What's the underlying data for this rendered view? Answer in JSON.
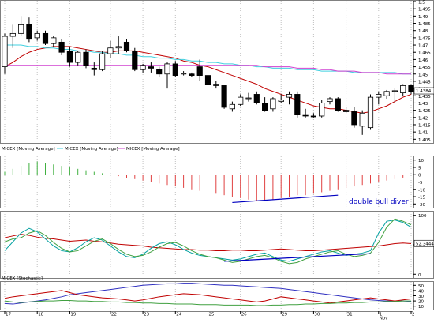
{
  "chart_data": [
    {
      "type": "candlestick",
      "title": "",
      "y_ticks": [
        "1.405",
        "1.41",
        "1.415",
        "1.42",
        "1.425",
        "1.43",
        "1.435",
        "1.44",
        "1.445",
        "1.45",
        "1.455",
        "1.46",
        "1.465",
        "1.47",
        "1.475",
        "1.48",
        "1.485",
        "1.49",
        "1.495",
        "1.5"
      ],
      "ylim": [
        1.403,
        1.5
      ],
      "last_value_label": "1.4384",
      "last_value": 1.4384,
      "legend": [
        {
          "label": "MICEX [Moving Average]",
          "color": "#a00000"
        },
        {
          "label": "MICEX [Moving Average]",
          "color": "#40d0e0"
        },
        {
          "label": "MICEX [Moving Average]",
          "color": "#d040d0"
        }
      ],
      "candles": [
        {
          "o": 1.455,
          "h": 1.478,
          "l": 1.45,
          "c": 1.476
        },
        {
          "o": 1.476,
          "h": 1.484,
          "l": 1.468,
          "c": 1.478
        },
        {
          "o": 1.478,
          "h": 1.49,
          "l": 1.476,
          "c": 1.484
        },
        {
          "o": 1.484,
          "h": 1.489,
          "l": 1.472,
          "c": 1.474
        },
        {
          "o": 1.475,
          "h": 1.48,
          "l": 1.473,
          "c": 1.478
        },
        {
          "o": 1.478,
          "h": 1.48,
          "l": 1.47,
          "c": 1.471
        },
        {
          "o": 1.471,
          "h": 1.476,
          "l": 1.469,
          "c": 1.475
        },
        {
          "o": 1.472,
          "h": 1.474,
          "l": 1.463,
          "c": 1.465
        },
        {
          "o": 1.466,
          "h": 1.469,
          "l": 1.455,
          "c": 1.458
        },
        {
          "o": 1.458,
          "h": 1.466,
          "l": 1.456,
          "c": 1.465
        },
        {
          "o": 1.465,
          "h": 1.467,
          "l": 1.454,
          "c": 1.456
        },
        {
          "o": 1.454,
          "h": 1.458,
          "l": 1.449,
          "c": 1.453
        },
        {
          "o": 1.453,
          "h": 1.466,
          "l": 1.452,
          "c": 1.464
        },
        {
          "o": 1.464,
          "h": 1.473,
          "l": 1.461,
          "c": 1.468
        },
        {
          "o": 1.468,
          "h": 1.476,
          "l": 1.464,
          "c": 1.469
        },
        {
          "o": 1.472,
          "h": 1.474,
          "l": 1.465,
          "c": 1.466
        },
        {
          "o": 1.466,
          "h": 1.468,
          "l": 1.452,
          "c": 1.453
        },
        {
          "o": 1.453,
          "h": 1.457,
          "l": 1.451,
          "c": 1.456
        },
        {
          "o": 1.455,
          "h": 1.458,
          "l": 1.451,
          "c": 1.454
        },
        {
          "o": 1.453,
          "h": 1.455,
          "l": 1.448,
          "c": 1.45
        },
        {
          "o": 1.45,
          "h": 1.458,
          "l": 1.44,
          "c": 1.457
        },
        {
          "o": 1.457,
          "h": 1.459,
          "l": 1.448,
          "c": 1.449
        },
        {
          "o": 1.45,
          "h": 1.452,
          "l": 1.449,
          "c": 1.4505
        },
        {
          "o": 1.45,
          "h": 1.451,
          "l": 1.448,
          "c": 1.449
        },
        {
          "o": 1.455,
          "h": 1.46,
          "l": 1.445,
          "c": 1.449
        },
        {
          "o": 1.449,
          "h": 1.455,
          "l": 1.441,
          "c": 1.443
        },
        {
          "o": 1.443,
          "h": 1.445,
          "l": 1.44,
          "c": 1.442
        },
        {
          "o": 1.442,
          "h": 1.442,
          "l": 1.426,
          "c": 1.427
        },
        {
          "o": 1.426,
          "h": 1.431,
          "l": 1.424,
          "c": 1.429
        },
        {
          "o": 1.429,
          "h": 1.436,
          "l": 1.428,
          "c": 1.434
        },
        {
          "o": 1.433,
          "h": 1.437,
          "l": 1.431,
          "c": 1.4335
        },
        {
          "o": 1.436,
          "h": 1.438,
          "l": 1.429,
          "c": 1.43
        },
        {
          "o": 1.43,
          "h": 1.434,
          "l": 1.424,
          "c": 1.425
        },
        {
          "o": 1.426,
          "h": 1.434,
          "l": 1.424,
          "c": 1.433
        },
        {
          "o": 1.431,
          "h": 1.436,
          "l": 1.43,
          "c": 1.432
        },
        {
          "o": 1.434,
          "h": 1.438,
          "l": 1.429,
          "c": 1.436
        },
        {
          "o": 1.436,
          "h": 1.438,
          "l": 1.42,
          "c": 1.422
        },
        {
          "o": 1.422,
          "h": 1.426,
          "l": 1.42,
          "c": 1.421
        },
        {
          "o": 1.421,
          "h": 1.423,
          "l": 1.42,
          "c": 1.4205
        },
        {
          "o": 1.421,
          "h": 1.432,
          "l": 1.42,
          "c": 1.43
        },
        {
          "o": 1.431,
          "h": 1.434,
          "l": 1.429,
          "c": 1.433
        },
        {
          "o": 1.433,
          "h": 1.434,
          "l": 1.424,
          "c": 1.425
        },
        {
          "o": 1.425,
          "h": 1.427,
          "l": 1.423,
          "c": 1.424
        },
        {
          "o": 1.424,
          "h": 1.427,
          "l": 1.413,
          "c": 1.415
        },
        {
          "o": 1.414,
          "h": 1.425,
          "l": 1.408,
          "c": 1.423
        },
        {
          "o": 1.413,
          "h": 1.436,
          "l": 1.412,
          "c": 1.434
        },
        {
          "o": 1.434,
          "h": 1.438,
          "l": 1.429,
          "c": 1.436
        },
        {
          "o": 1.435,
          "h": 1.439,
          "l": 1.433,
          "c": 1.438
        },
        {
          "o": 1.438,
          "h": 1.44,
          "l": 1.43,
          "c": 1.4385
        },
        {
          "o": 1.437,
          "h": 1.443,
          "l": 1.435,
          "c": 1.442
        },
        {
          "o": 1.442,
          "h": 1.443,
          "l": 1.436,
          "c": 1.438
        }
      ],
      "moving_averages": [
        {
          "color": "#c00000",
          "values": [
            1.455,
            1.458,
            1.462,
            1.465,
            1.467,
            1.468,
            1.469,
            1.469,
            1.469,
            1.468,
            1.467,
            1.466,
            1.465,
            1.465,
            1.466,
            1.466,
            1.466,
            1.465,
            1.464,
            1.463,
            1.462,
            1.461,
            1.459,
            1.458,
            1.456,
            1.455,
            1.453,
            1.451,
            1.449,
            1.447,
            1.445,
            1.443,
            1.44,
            1.438,
            1.436,
            1.434,
            1.432,
            1.43,
            1.428,
            1.427,
            1.426,
            1.426,
            1.425,
            1.424,
            1.423,
            1.424,
            1.426,
            1.428,
            1.431,
            1.434,
            1.436
          ]
        },
        {
          "color": "#40d0e0",
          "values": [
            1.47,
            1.47,
            1.47,
            1.469,
            1.469,
            1.468,
            1.468,
            1.467,
            1.467,
            1.466,
            1.466,
            1.465,
            1.465,
            1.464,
            1.464,
            1.463,
            1.463,
            1.462,
            1.462,
            1.461,
            1.461,
            1.46,
            1.46,
            1.459,
            1.459,
            1.458,
            1.458,
            1.457,
            1.457,
            1.456,
            1.456,
            1.455,
            1.455,
            1.454,
            1.454,
            1.454,
            1.453,
            1.453,
            1.453,
            1.452,
            1.452,
            1.452,
            1.452,
            1.451,
            1.451,
            1.451,
            1.451,
            1.451,
            1.451,
            1.45,
            1.45
          ]
        },
        {
          "color": "#d040d0",
          "values": [
            1.456,
            1.456,
            1.456,
            1.456,
            1.456,
            1.456,
            1.456,
            1.456,
            1.456,
            1.456,
            1.456,
            1.456,
            1.456,
            1.456,
            1.456,
            1.456,
            1.456,
            1.456,
            1.456,
            1.456,
            1.456,
            1.456,
            1.456,
            1.456,
            1.456,
            1.456,
            1.456,
            1.456,
            1.456,
            1.456,
            1.456,
            1.456,
            1.455,
            1.455,
            1.455,
            1.455,
            1.454,
            1.454,
            1.454,
            1.453,
            1.453,
            1.452,
            1.452,
            1.452,
            1.451,
            1.451,
            1.451,
            1.45,
            1.45,
            1.45,
            1.45
          ]
        }
      ]
    },
    {
      "type": "bar",
      "subtype": "histogram",
      "y_ticks": [
        "10",
        "5",
        "0",
        "-5",
        "-10",
        "-15",
        "-20"
      ],
      "ylim": [
        -22,
        12
      ],
      "values": [
        2,
        4,
        6,
        8,
        9,
        8,
        7,
        6,
        5,
        4,
        3,
        2,
        1,
        0,
        -1,
        -2,
        -3,
        -4,
        -5,
        -6,
        -7,
        -8,
        -9,
        -10,
        -11,
        -12,
        -13,
        -14,
        -15,
        -16,
        -17,
        -18,
        -18,
        -17,
        -16,
        -15,
        -14,
        -14,
        -13,
        -12,
        -11,
        -10,
        -9,
        -8,
        -7,
        -6,
        -5,
        -4,
        -3,
        -2
      ],
      "annotation_text": "double bull diver",
      "trendline": {
        "from_index": 28,
        "from_value": -19,
        "to_index": 41,
        "to_value": -14
      }
    },
    {
      "type": "line",
      "y_ticks": [
        "100",
        "50",
        "0"
      ],
      "ylim": [
        -5,
        105
      ],
      "last_value_label": "52.3444",
      "last_value": 52.3444,
      "series": [
        {
          "color": "#c00000",
          "values": [
            62,
            65,
            68,
            66,
            63,
            61,
            60,
            58,
            56,
            57,
            58,
            56,
            55,
            53,
            51,
            50,
            49,
            48,
            46,
            45,
            44,
            43,
            42,
            42,
            41,
            41,
            40,
            40,
            41,
            41,
            40,
            40,
            41,
            42,
            43,
            42,
            41,
            40,
            40,
            41,
            42,
            43,
            44,
            45,
            46,
            47,
            48,
            50,
            52,
            53,
            52
          ]
        },
        {
          "color": "#00a0a0",
          "values": [
            40,
            55,
            70,
            78,
            72,
            60,
            48,
            40,
            38,
            45,
            55,
            62,
            58,
            48,
            38,
            30,
            28,
            34,
            44,
            52,
            55,
            50,
            42,
            36,
            32,
            30,
            28,
            26,
            24,
            26,
            30,
            34,
            36,
            30,
            24,
            22,
            26,
            30,
            34,
            38,
            40,
            36,
            32,
            34,
            36,
            40,
            70,
            90,
            92,
            88,
            80
          ]
        },
        {
          "color": "#40a040",
          "values": [
            55,
            60,
            62,
            70,
            74,
            66,
            54,
            44,
            38,
            40,
            48,
            56,
            60,
            52,
            42,
            34,
            30,
            32,
            38,
            46,
            52,
            54,
            48,
            40,
            34,
            30,
            28,
            24,
            20,
            22,
            26,
            30,
            32,
            28,
            22,
            18,
            20,
            26,
            30,
            34,
            38,
            40,
            34,
            30,
            32,
            36,
            54,
            80,
            94,
            90,
            84
          ]
        }
      ],
      "trendline": {
        "from_index": 27,
        "from_value": 22,
        "to_index": 45,
        "to_value": 35
      }
    },
    {
      "type": "line",
      "title": "MICEX [Stochastic]",
      "y_ticks": [
        "50",
        "40",
        "30",
        "20",
        "10"
      ],
      "ylim": [
        5,
        55
      ],
      "series": [
        {
          "color": "#3030c0",
          "values": [
            15,
            14,
            16,
            18,
            20,
            22,
            25,
            28,
            32,
            34,
            36,
            38,
            40,
            42,
            44,
            46,
            48,
            50,
            51,
            52,
            53,
            53,
            54,
            54,
            53,
            52,
            51,
            50,
            50,
            49,
            48,
            47,
            46,
            45,
            44,
            42,
            40,
            38,
            36,
            34,
            32,
            30,
            28,
            26,
            24,
            22,
            21,
            20,
            20,
            20,
            19
          ]
        },
        {
          "color": "#c00000",
          "values": [
            25,
            28,
            30,
            32,
            34,
            36,
            38,
            40,
            36,
            32,
            30,
            28,
            26,
            25,
            24,
            22,
            20,
            22,
            25,
            28,
            30,
            32,
            34,
            33,
            32,
            30,
            28,
            26,
            24,
            22,
            20,
            18,
            20,
            24,
            28,
            26,
            24,
            22,
            20,
            18,
            16,
            18,
            20,
            22,
            24,
            26,
            24,
            22,
            20,
            22,
            24
          ]
        },
        {
          "color": "#40a040",
          "values": [
            20,
            18,
            17,
            18,
            19,
            20,
            20,
            21,
            21,
            20,
            20,
            19,
            19,
            18,
            18,
            17,
            17,
            16,
            16,
            15,
            15,
            14,
            14,
            14,
            13,
            13,
            13,
            12,
            12,
            12,
            12,
            11,
            11,
            12,
            12,
            13,
            13,
            14,
            14,
            15,
            15,
            16,
            16,
            17,
            17,
            18,
            18,
            19,
            19,
            20,
            20
          ]
        }
      ]
    }
  ],
  "x_axis": {
    "labels": [
      "17",
      "18",
      "19",
      "22",
      "23",
      "24",
      "25",
      "26",
      "29",
      "30",
      "31",
      "1",
      "2"
    ],
    "label_indices": [
      0,
      4,
      8,
      13,
      17,
      21,
      25,
      29,
      34,
      38,
      42,
      46,
      50
    ],
    "month_label": "Nov",
    "month_label_index": 46
  }
}
